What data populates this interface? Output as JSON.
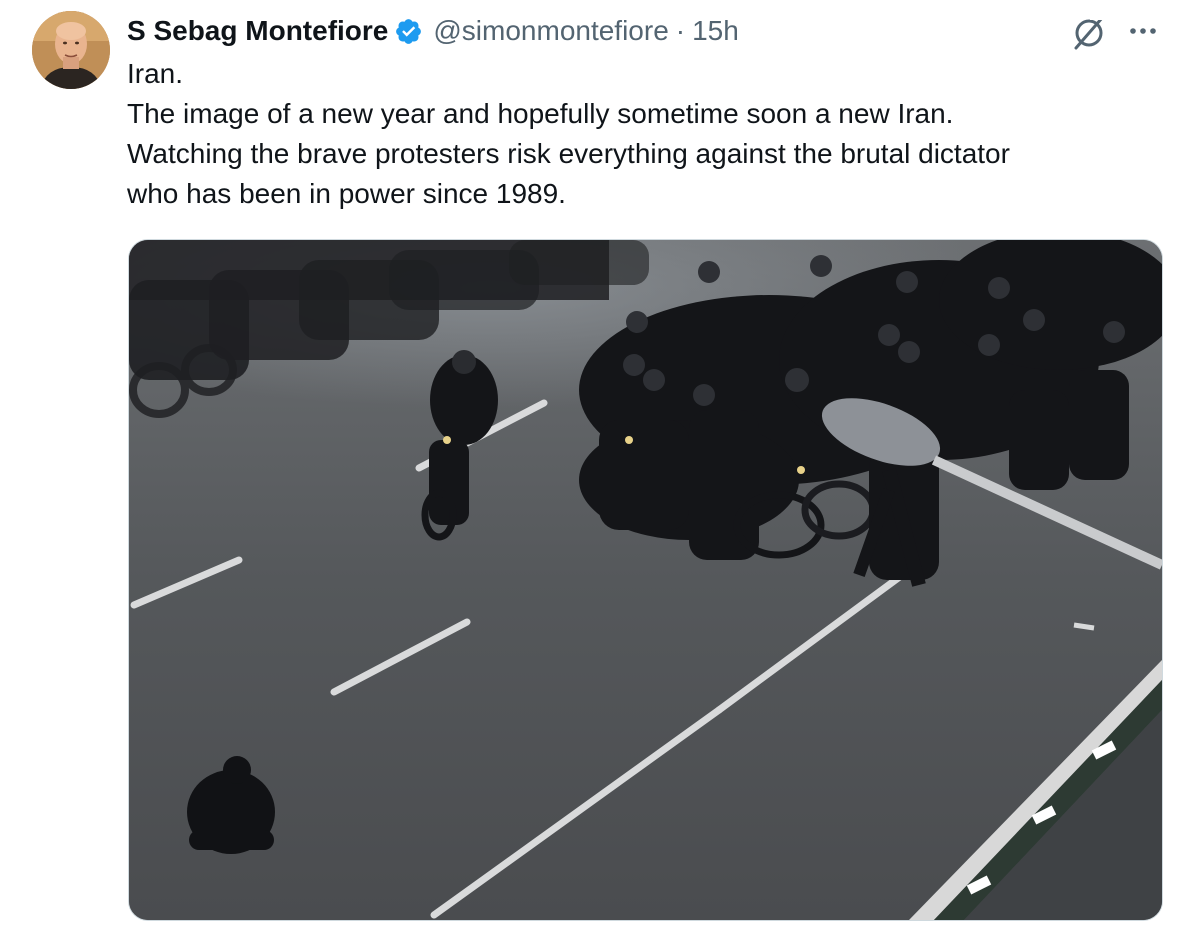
{
  "author": {
    "display_name": "S Sebag Montefiore",
    "verified": true,
    "handle": "@simonmontefiore",
    "separator": "·",
    "time": "15h",
    "avatar_icon": "avatar-photo"
  },
  "tweet": {
    "lines": [
      "Iran.",
      "The image of a new year and hopefully sometime soon a new Iran.",
      "Watching the brave protesters risk everything against the brutal dictator",
      "who has been in power since 1989."
    ]
  },
  "actions": {
    "grok_icon": "grok-icon",
    "more_icon": "more-icon"
  },
  "media": {
    "type": "photo",
    "icon": "photo-street-protest"
  },
  "colors": {
    "text_primary": "#0f1419",
    "text_secondary": "#536471",
    "verified_blue": "#1d9bf0",
    "border": "#cfd9de"
  }
}
